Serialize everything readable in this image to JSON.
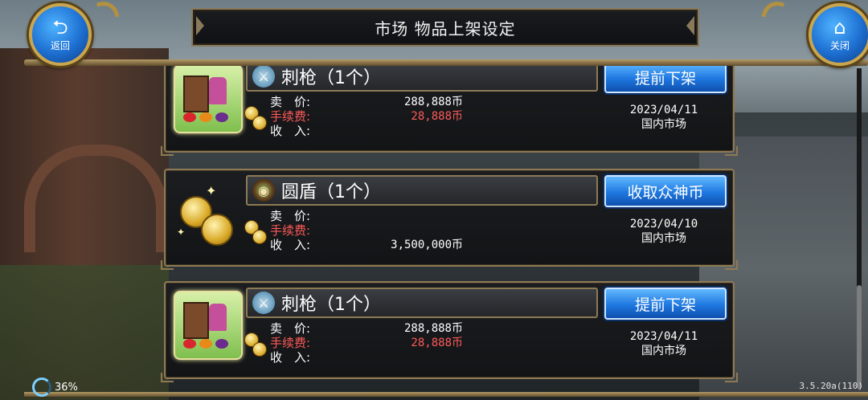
{
  "header": {
    "title": "市场 物品上架设定",
    "back_label": "返回",
    "close_label": "关闭",
    "back_icon": "return-arrow-icon",
    "close_icon": "home-icon"
  },
  "labels": {
    "price": "卖　价:",
    "fee": "手续费:",
    "income": "收　入:"
  },
  "listings": [
    {
      "thumb": "shop-stall",
      "item_icon": "spear-icon",
      "name": "刺枪（1个）",
      "button": "提前下架",
      "price": "288,888币",
      "fee": "28,888币",
      "income": "",
      "date": "2023/04/11",
      "market": "国内市场"
    },
    {
      "thumb": "gold-coins",
      "item_icon": "round-shield-icon",
      "name": "圆盾（1个）",
      "button": "收取众神币",
      "price": "",
      "fee": "",
      "income": "3,500,000币",
      "date": "2023/04/10",
      "market": "国内市场"
    },
    {
      "thumb": "shop-stall",
      "item_icon": "spear-icon",
      "name": "刺枪（1个）",
      "button": "提前下架",
      "price": "288,888币",
      "fee": "28,888币",
      "income": "",
      "date": "2023/04/11",
      "market": "国内市场"
    }
  ],
  "status": {
    "battery": "36%",
    "version": "3.5.20a(110)"
  },
  "colors": {
    "fee_text": "#ff5a5a",
    "button_blue": "#1e78e0",
    "frame_gold": "#8d7a55"
  }
}
